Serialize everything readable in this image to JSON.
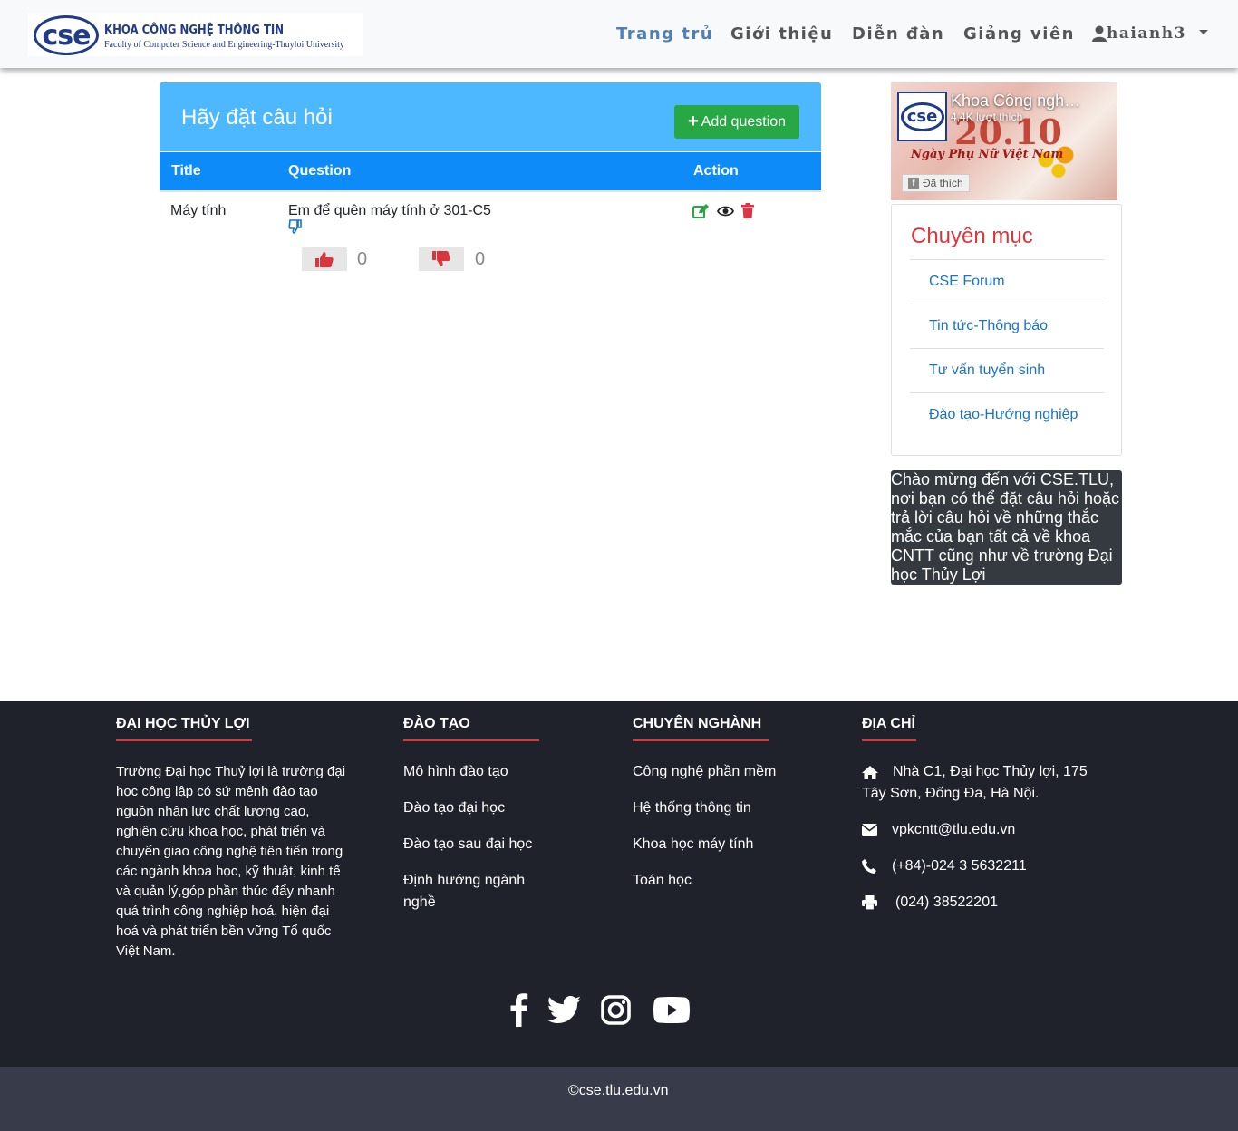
{
  "nav": {
    "logo_title": "KHOA CÔNG NGHỆ THÔNG TIN",
    "logo_subtitle": "Faculty of Computer Science and Engineering-Thuyloi University",
    "logo_mark": "cse",
    "links": [
      "Trang trủ",
      "Giới thiệu",
      "Diễn đàn",
      "Giảng viên"
    ],
    "active": "Trang trủ",
    "user": "haianh3"
  },
  "main": {
    "title": "Hãy đặt câu hỏi",
    "add_button": "Add question",
    "columns": [
      "Title",
      "Question",
      "Action"
    ],
    "rows": [
      {
        "title": "Máy tính",
        "question": "Em để quên máy tính ở 301-C5",
        "likes": "0",
        "dislikes": "0"
      }
    ]
  },
  "sidebar": {
    "fb_page_name": "Khoa Công nghệ Thông tin",
    "fb_likes": "4,4K lượt thích",
    "fb_liked_button": "Đã thích",
    "fb_banner_big": "20.10",
    "fb_banner_caption": "Ngày Phụ Nữ Việt Nam",
    "categories_title": "Chuyên mục",
    "categories": [
      "CSE Forum",
      "Tin tức-Thông báo",
      "Tư vấn tuyển sinh",
      "Đào tạo-Hướng nghiệp"
    ],
    "welcome": "Chào mừng đến với CSE.TLU, nơi bạn có thể đặt câu hỏi hoặc trả lời câu hỏi về những thắc mắc của bạn tất cả về khoa CNTT cũng như về trường Đại học Thủy Lợi"
  },
  "footer": {
    "col1": {
      "heading": "ĐẠI HỌC THỦY LỢI",
      "text": "Trường Đại học Thuỷ lợi là trường đại học công lập có sứ mệnh đào tạo nguồn nhân lực chất lượng cao, nghiên cứu khoa học, phát triển và chuyển giao công nghệ tiên tiến trong các ngành khoa học, kỹ thuật, kinh tế và quản lý,góp phần thúc đẩy nhanh quá trình công nghiệp hoá, hiện đại hoá và phát triển bền vững Tổ quốc Việt Nam."
    },
    "col2": {
      "heading": "ĐÀO TẠO",
      "links": [
        "Mô hình đào tạo",
        "Đào tạo đại học",
        "Đào tạo sau đại học",
        "Định hướng ngành nghề"
      ]
    },
    "col3": {
      "heading": "CHUYÊN NGHÀNH",
      "links": [
        "Công nghệ phần mềm",
        "Hệ thống thông tin",
        "Khoa học máy tính",
        "Toán học"
      ]
    },
    "col4": {
      "heading": "ĐỊA CHỈ",
      "address": "Nhà C1, Đại học Thủy lợi, 175 Tây Sơn, Đống Đa, Hà Nội.",
      "email": "vpkcntt@tlu.edu.vn",
      "phone": "(+84)-024 3 5632211",
      "fax": "(024) 38522201"
    },
    "socials": [
      "facebook-icon",
      "twitter-icon",
      "instagram-icon",
      "youtube-icon"
    ],
    "copyright": "©cse.tlu.edu.vn"
  },
  "colors": {
    "card_header": "#4db8ff",
    "table_header": "#0d8cf9",
    "add_button": "#28a745",
    "accent_red": "#d9363e",
    "footer_bg": "#1f222b",
    "copyright_bg": "#383b49"
  }
}
